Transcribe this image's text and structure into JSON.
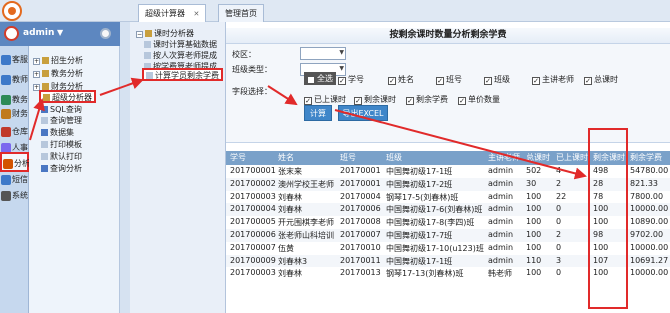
{
  "tabs": [
    {
      "label": "超级计算器",
      "active": true
    },
    {
      "label": "管理首页",
      "active": false
    }
  ],
  "user": {
    "name": "admin"
  },
  "left_nav": [
    {
      "label": "客服",
      "color": "#3d79c9"
    },
    {
      "label": "教师",
      "color": "#3d79c9"
    },
    {
      "label": "教务",
      "color": "#2e8b57"
    },
    {
      "label": "财务",
      "color": "#c07a1c"
    },
    {
      "label": "仓库",
      "color": "#c0392b"
    },
    {
      "label": "人事",
      "color": "#7b68ee"
    },
    {
      "label": "分析",
      "color": "#d35400",
      "selected": true
    },
    {
      "label": "短信",
      "color": "#3d79c9"
    },
    {
      "label": "系统",
      "color": "#555555"
    }
  ],
  "tree": [
    {
      "label": "招生分析",
      "type": "folder"
    },
    {
      "label": "教务分析",
      "type": "folder"
    },
    {
      "label": "财务分析",
      "type": "folder"
    },
    {
      "label": "超级分析器",
      "type": "folder",
      "highlight": true
    },
    {
      "label": "SQL查询",
      "type": "doc"
    },
    {
      "label": "查询管理",
      "type": "doc"
    },
    {
      "label": "数据集",
      "type": "doc"
    },
    {
      "label": "打印模板",
      "type": "doc"
    },
    {
      "label": "默认打印",
      "type": "doc"
    },
    {
      "label": "查询分析",
      "type": "doc"
    }
  ],
  "subtree": [
    {
      "label": "课时分析器",
      "type": "root"
    },
    {
      "label": "课时计算基础数据",
      "type": "doc"
    },
    {
      "label": "按人次算老师提成",
      "type": "doc"
    },
    {
      "label": "按学费算老师提成",
      "type": "doc"
    },
    {
      "label": "计算学员剩余学费",
      "type": "doc",
      "highlight": true
    }
  ],
  "main": {
    "title": "按剩余课时数量分析剩余学费",
    "campus_label": "校区：",
    "class_type_label": "班级类型：",
    "fields_label": "字段选择：",
    "checkboxes_row1": [
      {
        "label": "全选",
        "checked": true,
        "dark": true
      },
      {
        "label": "学号",
        "checked": true
      },
      {
        "label": "姓名",
        "checked": true
      },
      {
        "label": "班号",
        "checked": true
      },
      {
        "label": "班级",
        "checked": true
      },
      {
        "label": "主讲老师",
        "checked": true
      },
      {
        "label": "总课时",
        "checked": true
      }
    ],
    "checkboxes_row2": [
      {
        "label": "已上课时",
        "checked": true
      },
      {
        "label": "剩余课时",
        "checked": true
      },
      {
        "label": "剩余学费",
        "checked": true
      },
      {
        "label": "单价数量",
        "checked": true
      }
    ],
    "compute_button": "计算",
    "export_button": "导出EXCEL"
  },
  "table": {
    "columns": [
      "学号",
      "姓名",
      "班号",
      "班级",
      "主讲老师",
      "总课时",
      "已上课时",
      "剩余课时",
      "剩余学费"
    ],
    "rows": [
      [
        "201700001",
        "张末来",
        "20170001",
        "中国舞初级17-1班",
        "admin",
        "502",
        "4",
        "498",
        "54780.00"
      ],
      [
        "201700002",
        "澳州学校王老师",
        "20170001",
        "中国舞初级17-2班",
        "admin",
        "30",
        "2",
        "28",
        "821.33"
      ],
      [
        "201700003",
        "刘春林",
        "20170004",
        "钢琴17-5(刘春林)班",
        "admin",
        "100",
        "22",
        "78",
        "7800.00"
      ],
      [
        "201700004",
        "刘春林",
        "20170006",
        "中国舞初级17-6(刘春林)班",
        "admin",
        "100",
        "0",
        "100",
        "10000.00"
      ],
      [
        "201700005",
        "开元围棋李老师",
        "20170008",
        "中国舞初级17-8(李四)班",
        "admin",
        "100",
        "0",
        "100",
        "10890.00"
      ],
      [
        "201700006",
        "张老师山科培训",
        "20170007",
        "中国舞初级17-7班",
        "admin",
        "100",
        "2",
        "98",
        "9702.00"
      ],
      [
        "201700007",
        "伍黄",
        "20170010",
        "中国舞初级17-10(u123)班",
        "admin",
        "100",
        "0",
        "100",
        "10000.00"
      ],
      [
        "201700009",
        "刘春林3",
        "20170011",
        "中国舞初级17-1班",
        "admin",
        "110",
        "3",
        "107",
        "10691.27"
      ],
      [
        "201700003",
        "刘春林",
        "20170013",
        "钢琴17-13(刘春林)班",
        "韩老师",
        "100",
        "0",
        "100",
        "10000.00"
      ]
    ]
  },
  "colors": {
    "highlight": "#e12a2a",
    "header": "#7aa1c9",
    "button": "#3f86c9"
  }
}
